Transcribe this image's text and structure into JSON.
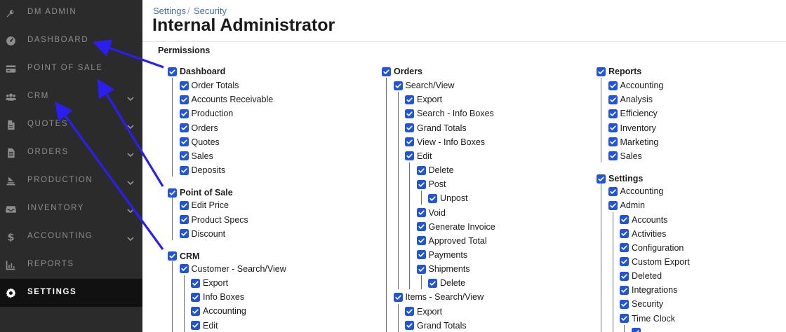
{
  "sidebar": {
    "items": [
      {
        "id": "dm-admin",
        "label": "DM ADMIN",
        "icon": "wrench-icon",
        "chevron": false,
        "active": false
      },
      {
        "id": "dashboard",
        "label": "DASHBOARD",
        "icon": "dashboard-gauge-icon",
        "chevron": false,
        "active": false
      },
      {
        "id": "point-of-sale",
        "label": "POINT OF SALE",
        "icon": "credit-card-icon",
        "chevron": false,
        "active": false
      },
      {
        "id": "crm",
        "label": "CRM",
        "icon": "users-icon",
        "chevron": true,
        "active": false
      },
      {
        "id": "quotes",
        "label": "QUOTES",
        "icon": "file-icon",
        "chevron": true,
        "active": false
      },
      {
        "id": "orders",
        "label": "ORDERS",
        "icon": "file-list-icon",
        "chevron": true,
        "active": false
      },
      {
        "id": "production",
        "label": "PRODUCTION",
        "icon": "layers-icon",
        "chevron": true,
        "active": false
      },
      {
        "id": "inventory",
        "label": "INVENTORY",
        "icon": "inbox-icon",
        "chevron": true,
        "active": false
      },
      {
        "id": "accounting",
        "label": "ACCOUNTING",
        "icon": "dollar-icon",
        "chevron": true,
        "active": false
      },
      {
        "id": "reports",
        "label": "REPORTS",
        "icon": "chart-icon",
        "chevron": false,
        "active": false
      },
      {
        "id": "settings",
        "label": "SETTINGS",
        "icon": "gear-icon",
        "chevron": false,
        "active": true
      }
    ]
  },
  "header": {
    "breadcrumb": [
      "Settings",
      "Security"
    ],
    "separator": "/",
    "title": "Internal Administrator"
  },
  "permissions": {
    "heading": "Permissions",
    "columns": [
      {
        "items": [
          {
            "label": "Dashboard",
            "checked": true,
            "children": [
              {
                "label": "Order Totals",
                "checked": true
              },
              {
                "label": "Accounts Receivable",
                "checked": true
              },
              {
                "label": "Production",
                "checked": true
              },
              {
                "label": "Orders",
                "checked": true
              },
              {
                "label": "Quotes",
                "checked": true
              },
              {
                "label": "Sales",
                "checked": true
              },
              {
                "label": "Deposits",
                "checked": true
              }
            ]
          },
          {
            "label": "Point of Sale",
            "checked": true,
            "children": [
              {
                "label": "Edit Price",
                "checked": true
              },
              {
                "label": "Product Specs",
                "checked": true
              },
              {
                "label": "Discount",
                "checked": true
              }
            ]
          },
          {
            "label": "CRM",
            "checked": true,
            "children": [
              {
                "label": "Customer - Search/View",
                "checked": true,
                "children": [
                  {
                    "label": "Export",
                    "checked": true
                  },
                  {
                    "label": "Info Boxes",
                    "checked": true
                  },
                  {
                    "label": "Accounting",
                    "checked": true
                  },
                  {
                    "label": "Edit",
                    "checked": true
                  }
                ]
              }
            ]
          }
        ]
      },
      {
        "items": [
          {
            "label": "Orders",
            "checked": true,
            "children": [
              {
                "label": "Search/View",
                "checked": true,
                "children": [
                  {
                    "label": "Export",
                    "checked": true
                  },
                  {
                    "label": "Search - Info Boxes",
                    "checked": true
                  },
                  {
                    "label": "Grand Totals",
                    "checked": true
                  },
                  {
                    "label": "View - Info Boxes",
                    "checked": true
                  },
                  {
                    "label": "Edit",
                    "checked": true,
                    "children": [
                      {
                        "label": "Delete",
                        "checked": true
                      },
                      {
                        "label": "Post",
                        "checked": true,
                        "children": [
                          {
                            "label": "Unpost",
                            "checked": true
                          }
                        ]
                      },
                      {
                        "label": "Void",
                        "checked": true
                      },
                      {
                        "label": "Generate Invoice",
                        "checked": true
                      },
                      {
                        "label": "Approved Total",
                        "checked": true
                      },
                      {
                        "label": "Payments",
                        "checked": true
                      },
                      {
                        "label": "Shipments",
                        "checked": true,
                        "children": [
                          {
                            "label": "Delete",
                            "checked": true
                          }
                        ]
                      }
                    ]
                  }
                ]
              },
              {
                "label": "Items - Search/View",
                "checked": true,
                "children": [
                  {
                    "label": "Export",
                    "checked": true
                  },
                  {
                    "label": "Grand Totals",
                    "checked": true
                  }
                ]
              }
            ]
          }
        ]
      },
      {
        "items": [
          {
            "label": "Reports",
            "checked": true,
            "children": [
              {
                "label": "Accounting",
                "checked": true
              },
              {
                "label": "Analysis",
                "checked": true
              },
              {
                "label": "Efficiency",
                "checked": true
              },
              {
                "label": "Inventory",
                "checked": true
              },
              {
                "label": "Marketing",
                "checked": true
              },
              {
                "label": "Sales",
                "checked": true
              }
            ]
          },
          {
            "label": "Settings",
            "checked": true,
            "children": [
              {
                "label": "Accounting",
                "checked": true
              },
              {
                "label": "Admin",
                "checked": true,
                "children": [
                  {
                    "label": "Accounts",
                    "checked": true
                  },
                  {
                    "label": "Activities",
                    "checked": true
                  },
                  {
                    "label": "Configuration",
                    "checked": true
                  },
                  {
                    "label": "Custom Export",
                    "checked": true
                  },
                  {
                    "label": "Deleted",
                    "checked": true
                  },
                  {
                    "label": "Integrations",
                    "checked": true
                  },
                  {
                    "label": "Security",
                    "checked": true
                  },
                  {
                    "label": "Time Clock",
                    "checked": true,
                    "children": [
                      {
                        "label": "",
                        "checked": true
                      }
                    ]
                  }
                ]
              }
            ]
          }
        ]
      }
    ]
  },
  "colors": {
    "sidebar_bg": "#2b2b2b",
    "sidebar_active_bg": "#111111",
    "checkbox": "#1f55d6",
    "link": "#3d6ea5",
    "annotation_arrow": "#2a1ff0"
  }
}
